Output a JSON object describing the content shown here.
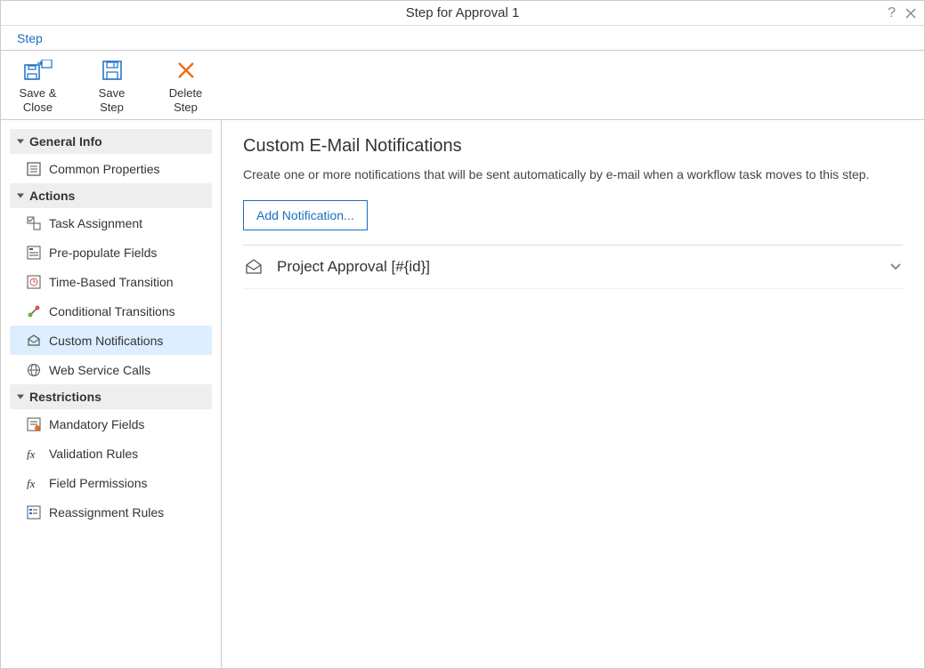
{
  "dialog": {
    "title": "Step for Approval 1"
  },
  "menubar": {
    "step": "Step"
  },
  "toolbar": {
    "saveClose": {
      "line1": "Save &",
      "line2": "Close"
    },
    "saveStep": {
      "line1": "Save",
      "line2": "Step"
    },
    "deleteStep": {
      "line1": "Delete",
      "line2": "Step"
    }
  },
  "sidebar": {
    "sections": {
      "generalInfo": {
        "header": "General Info",
        "items": {
          "commonProperties": "Common Properties"
        }
      },
      "actions": {
        "header": "Actions",
        "items": {
          "taskAssignment": "Task Assignment",
          "prepopulateFields": "Pre-populate Fields",
          "timeBasedTransition": "Time-Based Transition",
          "conditionalTransitions": "Conditional Transitions",
          "customNotifications": "Custom Notifications",
          "webServiceCalls": "Web Service Calls"
        }
      },
      "restrictions": {
        "header": "Restrictions",
        "items": {
          "mandatoryFields": "Mandatory Fields",
          "validationRules": "Validation Rules",
          "fieldPermissions": "Field Permissions",
          "reassignmentRules": "Reassignment Rules"
        }
      }
    }
  },
  "main": {
    "title": "Custom E-Mail Notifications",
    "description": "Create one or more notifications that will be sent automatically by e-mail when a workflow task moves to this step.",
    "addButton": "Add Notification...",
    "notifications": [
      {
        "label": "Project Approval [#{id}]"
      }
    ]
  }
}
